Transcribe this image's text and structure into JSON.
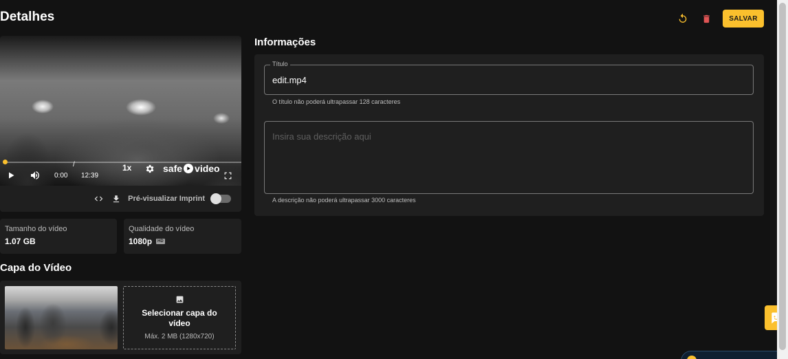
{
  "header": {
    "title": "Detalhes",
    "save_label": "SALVAR"
  },
  "player": {
    "current_time": "0:00",
    "separator": "/",
    "duration": "12:39",
    "speed": "1x",
    "brand_left": "safe",
    "brand_right": "video",
    "progress": 0,
    "imprint_label": "Pré-visualizar Imprint"
  },
  "stats": {
    "size_label": "Tamanho do vídeo",
    "size_value": "1.07 GB",
    "quality_label": "Qualidade do vídeo",
    "quality_value": "1080p",
    "quality_badge": "HD"
  },
  "cover": {
    "section_title": "Capa do Vídeo",
    "select_label": "Selecionar capa do vídeo",
    "select_hint": "Máx. 2 MB (1280x720)"
  },
  "info": {
    "section_title": "Informações",
    "title_legend": "Título",
    "title_value": "edit.mp4",
    "title_helper": "O título não poderá ultrapassar 128 caracteres",
    "desc_placeholder": "Insira sua descrição aqui",
    "desc_helper": "A descrição não poderá ultrapassar 3000 caracteres"
  },
  "colors": {
    "accent": "#fbc02d",
    "delete": "#e05555",
    "background": "#121212",
    "panel": "#1f1f1f"
  },
  "icons": {
    "undo": "undo-icon",
    "delete": "trash-icon",
    "play": "play-icon",
    "volume": "volume-icon",
    "settings": "gear-icon",
    "fullscreen": "fullscreen-icon",
    "embed": "code-icon",
    "download": "download-icon",
    "image": "image-icon",
    "chat": "chat-icon"
  }
}
